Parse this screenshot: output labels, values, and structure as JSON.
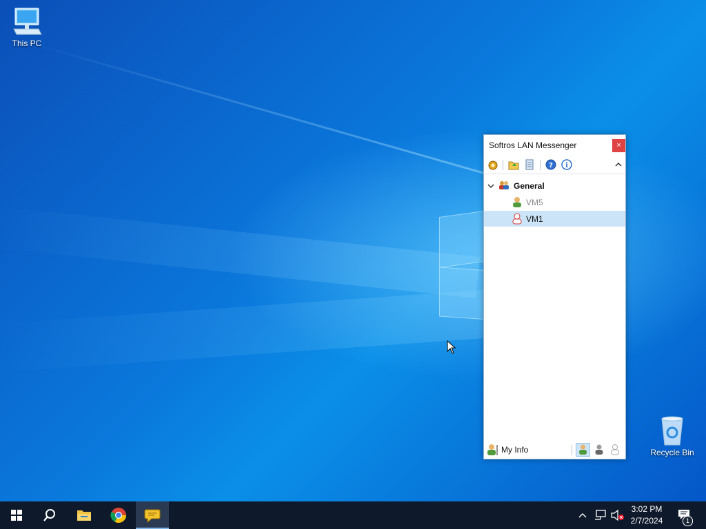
{
  "desktop": {
    "icons": [
      {
        "label": "This PC",
        "icon": "computer-icon"
      },
      {
        "label": "Recycle Bin",
        "icon": "recycle-bin-icon"
      }
    ]
  },
  "messenger": {
    "title": "Softros LAN Messenger",
    "close_label": "×",
    "toolbar": [
      "settings-icon",
      "folder-icon",
      "history-icon",
      "help-icon",
      "info-icon",
      "collapse-chevron-icon"
    ],
    "group": {
      "label": "General",
      "expanded": true
    },
    "contacts": [
      {
        "name": "VM5",
        "status": "offline",
        "selected": false
      },
      {
        "name": "VM1",
        "status": "away",
        "selected": true
      }
    ],
    "my_info_label": "My Info",
    "status_buttons": [
      "available",
      "busy",
      "offline"
    ]
  },
  "taskbar": {
    "apps": [
      "start-icon",
      "search-icon",
      "file-explorer-icon",
      "chrome-icon",
      "softros-messenger-icon"
    ],
    "active_app": "softros-messenger-icon",
    "tray_icons": [
      "show-hidden-icons-chevron",
      "network-icon",
      "volume-muted-icon"
    ],
    "time": "3:02 PM",
    "date": "2/7/2024",
    "notification_count": "1"
  },
  "colors": {
    "taskbar_bg": "#0e1a2b",
    "selection": "#cce4f7",
    "close_button": "#e04343"
  }
}
